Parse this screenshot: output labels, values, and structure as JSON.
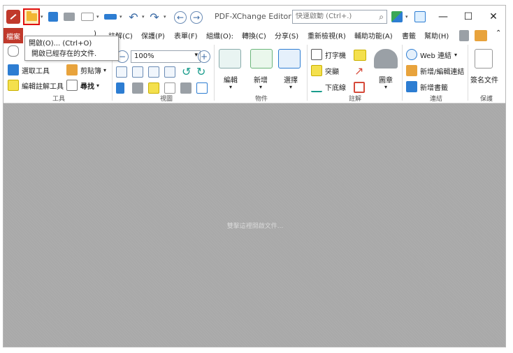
{
  "title_bar": {
    "app_title": "PDF-XChange Editor",
    "search_placeholder": "快速啟動 (Ctrl+.)",
    "minimize": "—",
    "maximize": "☐",
    "close": "✕"
  },
  "menu": {
    "file": "檔案",
    "items": [
      "註解(C)",
      "保護(P)",
      "表單(F)",
      "組織(O):",
      "轉換(C)",
      "分享(S)",
      "重新檢視(R)",
      "輔助功能(A)",
      "書籤",
      "幫助(H)"
    ],
    "partial_hidden": ")"
  },
  "tooltip": {
    "title": "開啟(O)... (Ctrl+O)",
    "description": "開啟已經存在的文件."
  },
  "ribbon": {
    "tools": {
      "select_tool": "選取工具",
      "clipboard": "剪貼簿",
      "edit_annotation_tool": "編輯註解工具",
      "find": "尋找",
      "group_label": "工具"
    },
    "view": {
      "zoom": "100%",
      "group_label": "視圖"
    },
    "objects": {
      "edit": "編輯",
      "add": "新增",
      "select": "選擇",
      "group_label": "物件"
    },
    "annotation": {
      "typewriter": "打字機",
      "highlight": "突顯",
      "underline": "下底線",
      "stamp": "圖章",
      "group_label": "註解"
    },
    "links": {
      "web_link": "Web 連結",
      "add_edit_link": "新增/編輯連結",
      "add_bookmark": "新增書籤",
      "group_label": "連結"
    },
    "protect": {
      "sign_document": "簽名文件",
      "group_label": "保護"
    }
  },
  "document_area": {
    "hint": "雙擊這裡開啟文件..."
  },
  "colors": {
    "file_tab": "#c0392b",
    "open_highlight": "#e01010",
    "doc_background": "#a9a9a9"
  }
}
